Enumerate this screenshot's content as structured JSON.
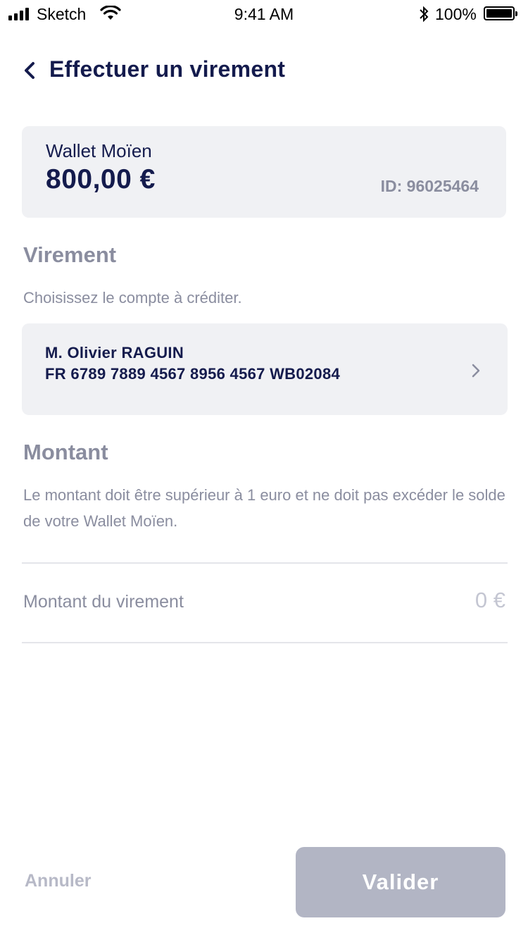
{
  "status_bar": {
    "carrier": "Sketch",
    "time": "9:41 AM",
    "battery": "100%"
  },
  "header": {
    "title": "Effectuer un virement",
    "back_icon": "chevron-left-icon"
  },
  "wallet": {
    "name": "Wallet Moïen",
    "balance": "800,00 €",
    "id": "ID: 96025464"
  },
  "transfer": {
    "title": "Virement",
    "description": "Choisissez le compte à créditer.",
    "beneficiary": {
      "name": "M. Olivier RAGUIN",
      "iban": "FR 6789 7889 4567 8956 4567 WB02084",
      "icon": "chevron-right-icon"
    }
  },
  "amount": {
    "title": "Montant",
    "description": "Le montant doit être supérieur à 1 euro et ne doit pas excéder le solde de votre Wallet Moïen.",
    "field_label": "Montant du virement",
    "placeholder": "0 €",
    "value": ""
  },
  "actions": {
    "cancel_label": "Annuler",
    "validate_label": "Valider"
  },
  "colors": {
    "primary_text": "#141b4d",
    "muted_text": "#8a8d9f",
    "card_background": "#f0f1f4",
    "button_disabled": "#b2b5c4"
  }
}
